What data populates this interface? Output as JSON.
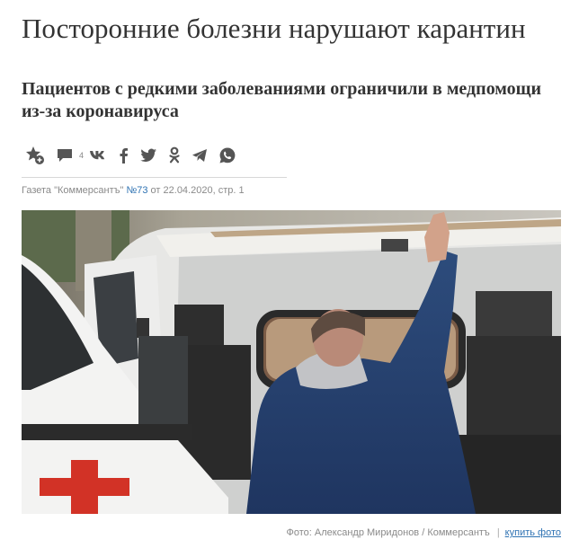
{
  "article": {
    "title": "Посторонние болезни нарушают карантин",
    "subtitle": "Пациентов с редкими заболеваниями ограничили в медпомощи из-за коронавируса"
  },
  "share": {
    "comments_count": "4",
    "icons": [
      "favorite-add-icon",
      "comments-icon",
      "vk-icon",
      "facebook-icon",
      "twitter-icon",
      "odnoklassniki-icon",
      "telegram-icon",
      "whatsapp-icon"
    ]
  },
  "meta": {
    "source_prefix": "Газета \"Коммерсантъ\" ",
    "issue": "№73",
    "date_text": " от 22.04.2020, стр. 1"
  },
  "photo": {
    "credit": "Фото: Александр Миридонов / Коммерсантъ",
    "separator": "|",
    "buy_link": "купить фото"
  },
  "colors": {
    "link": "#2f73b3",
    "text": "#333333",
    "meta": "#8a8a8a",
    "icon": "#555555"
  }
}
